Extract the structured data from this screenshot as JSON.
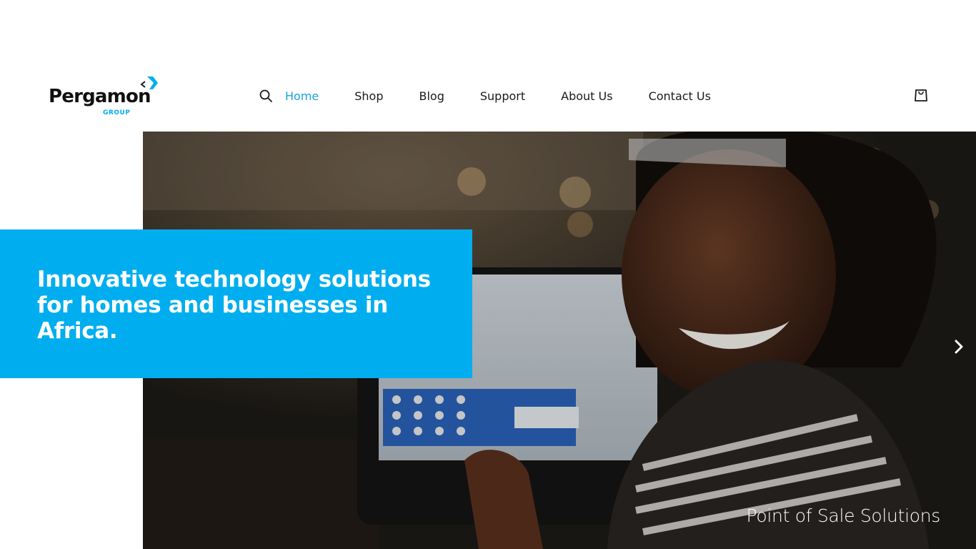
{
  "header": {
    "logo": {
      "name": "Pergamon",
      "sub": "GROUP"
    },
    "search_icon": "search-icon",
    "nav": [
      {
        "label": "Home",
        "active": true
      },
      {
        "label": "Shop",
        "active": false
      },
      {
        "label": "Blog",
        "active": false
      },
      {
        "label": "Support",
        "active": false
      },
      {
        "label": "About Us",
        "active": false
      },
      {
        "label": "Contact Us",
        "active": false
      }
    ],
    "cart_icon": "shopping-bag-icon"
  },
  "hero": {
    "tagline": "Innovative technology solutions for homes and businesses in Africa.",
    "caption": "Point of Sale Solutions",
    "next_icon": "chevron-right-icon"
  },
  "colors": {
    "accent": "#00aeef",
    "nav_active": "#1ba1e2",
    "text_dark": "#1a1a1a"
  }
}
